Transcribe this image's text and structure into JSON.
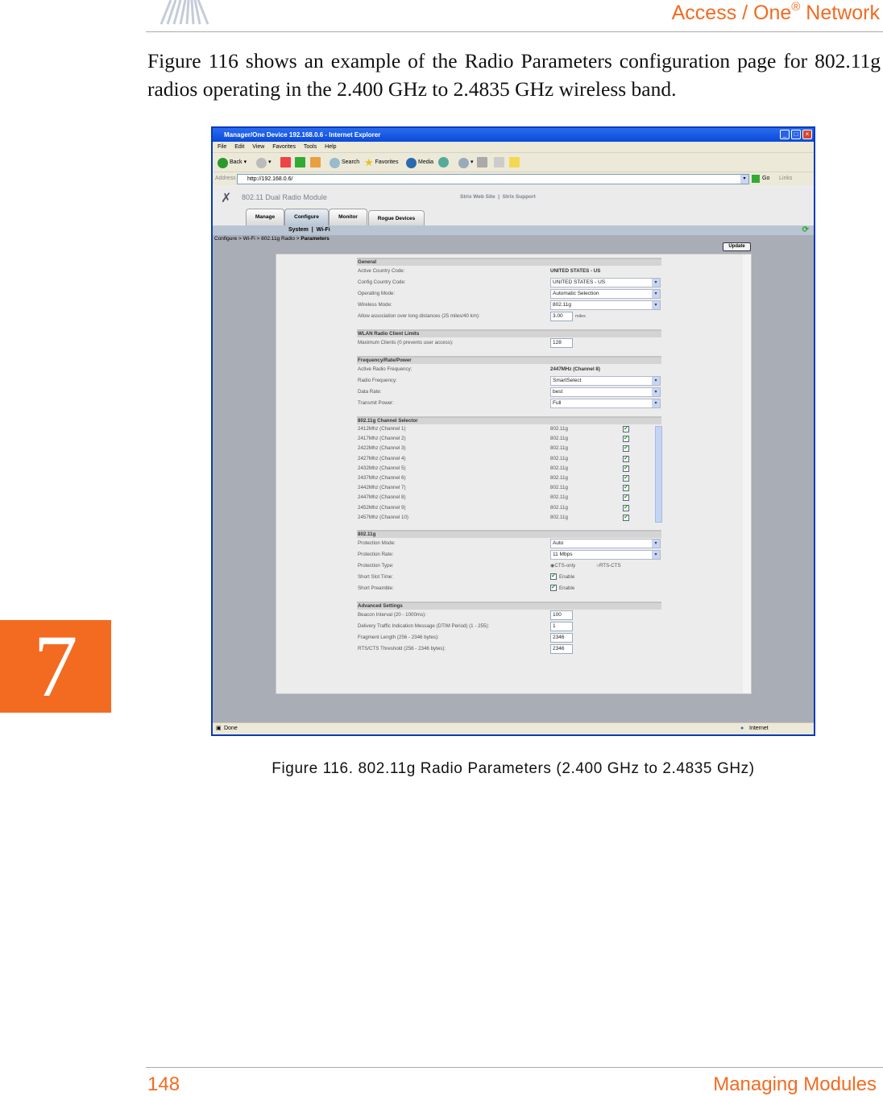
{
  "header": {
    "title": "Access / One",
    "registered": "®",
    "title_suffix": " Network"
  },
  "intro_paragraph": "Figure 116 shows an example of the Radio Parameters configuration page for 802.11g radios operating in the 2.400 GHz to 2.4835 GHz wireless band.",
  "chapter_number": "7",
  "caption": "Figure 116. 802.11g Radio Parameters (2.400 GHz to 2.4835 GHz)",
  "footer": {
    "page_number": "148",
    "section": "Managing Modules"
  },
  "colors": {
    "accent": "#f26b21",
    "xp_blue": "#0a47d6"
  },
  "browser": {
    "title": "Manager/One Device 192.168.0.6 - Internet Explorer",
    "menu": [
      "File",
      "Edit",
      "View",
      "Favorites",
      "Tools",
      "Help"
    ],
    "toolbar": {
      "back": "Back",
      "search": "Search",
      "favorites": "Favorites",
      "media": "Media"
    },
    "address_label": "Address",
    "address": "http://192.168.0.6/",
    "go": "Go",
    "links": "Links",
    "status": "Done",
    "zone": "Internet"
  },
  "app": {
    "name": "802.11 Dual Radio Module",
    "link_site": "Strix Web Site",
    "link_support": "Strix Support",
    "link_sep": "|",
    "tabs": [
      "Manage",
      "Configure",
      "Monitor",
      "Rogue Devices"
    ],
    "active_tab": "Configure",
    "subnav": [
      "System",
      "Wi-Fi"
    ],
    "breadcrumb": "Configure > Wi-Fi > 802.11g Radio > ",
    "breadcrumb_current": "Parameters",
    "update_label": "Update"
  },
  "sections": [
    {
      "title": "General",
      "rows": [
        {
          "label": "Active Country Code:",
          "type": "static",
          "value": "UNITED STATES - US"
        },
        {
          "label": "Config Country Code:",
          "type": "select",
          "value": "UNITED STATES - US"
        },
        {
          "label": "Operating Mode:",
          "type": "select",
          "value": "Automatic Selection"
        },
        {
          "label": "Wireless Mode:",
          "type": "select",
          "value": "802.11g"
        },
        {
          "label": "Allow association over long distances (25 miles/40 km):",
          "type": "text",
          "value": "3.00",
          "unit": "miles"
        }
      ]
    },
    {
      "title": "WLAN Radio Client Limits",
      "rows": [
        {
          "label": "Maximum Clients (0 prevents user access):",
          "type": "text",
          "value": "128"
        }
      ]
    },
    {
      "title": "Frequency/Rate/Power",
      "rows": [
        {
          "label": "Active Radio Frequency:",
          "type": "static",
          "value": "2447MHz (Channel 8)"
        },
        {
          "label": "Radio Frequency:",
          "type": "select",
          "value": "SmartSelect"
        },
        {
          "label": "Data Rate:",
          "type": "select",
          "value": "best"
        },
        {
          "label": "Transmit Power:",
          "type": "select",
          "value": "Full"
        }
      ]
    },
    {
      "title": "802.11g Channel Selector",
      "channels": true,
      "rows": [
        {
          "label": "2412Mhz (Channel 1)",
          "mode": "802.11g",
          "checked": true
        },
        {
          "label": "2417Mhz (Channel 2)",
          "mode": "802.11g",
          "checked": true
        },
        {
          "label": "2422Mhz (Channel 3)",
          "mode": "802.11g",
          "checked": true
        },
        {
          "label": "2427Mhz (Channel 4)",
          "mode": "802.11g",
          "checked": true
        },
        {
          "label": "2432Mhz (Channel 5)",
          "mode": "802.11g",
          "checked": true
        },
        {
          "label": "2437Mhz (Channel 6)",
          "mode": "802.11g",
          "checked": true
        },
        {
          "label": "2442Mhz (Channel 7)",
          "mode": "802.11g",
          "checked": true
        },
        {
          "label": "2447Mhz (Channel 8)",
          "mode": "802.11g",
          "checked": true
        },
        {
          "label": "2452Mhz (Channel 9)",
          "mode": "802.11g",
          "checked": true
        },
        {
          "label": "2457Mhz (Channel 10)",
          "mode": "802.11g",
          "checked": true
        }
      ]
    },
    {
      "title": "802.11g",
      "rows": [
        {
          "label": "Protection Mode:",
          "type": "select",
          "value": "Auto"
        },
        {
          "label": "Protection Rate:",
          "type": "select",
          "value": "11 Mbps"
        },
        {
          "label": "Protection Type:",
          "type": "radio",
          "options": [
            "CTS-only",
            "RTS-CTS"
          ],
          "selected": "CTS-only"
        },
        {
          "label": "Short Slot Time:",
          "type": "checkbox",
          "value": "Enable",
          "checked": true
        },
        {
          "label": "Short Preamble:",
          "type": "checkbox",
          "value": "Enable",
          "checked": true
        }
      ]
    },
    {
      "title": "Advanced Settings",
      "rows": [
        {
          "label": "Beacon Interval (20 - 1000ms):",
          "type": "text",
          "value": "100"
        },
        {
          "label": "Delivery Traffic Indication Message (DTIM Period) (1 - 255):",
          "type": "text",
          "value": "1"
        },
        {
          "label": "Fragment Length (256 - 2346 bytes):",
          "type": "text",
          "value": "2346"
        },
        {
          "label": "RTS/CTS Threshold (256 - 2346 bytes):",
          "type": "text",
          "value": "2346"
        }
      ]
    }
  ]
}
